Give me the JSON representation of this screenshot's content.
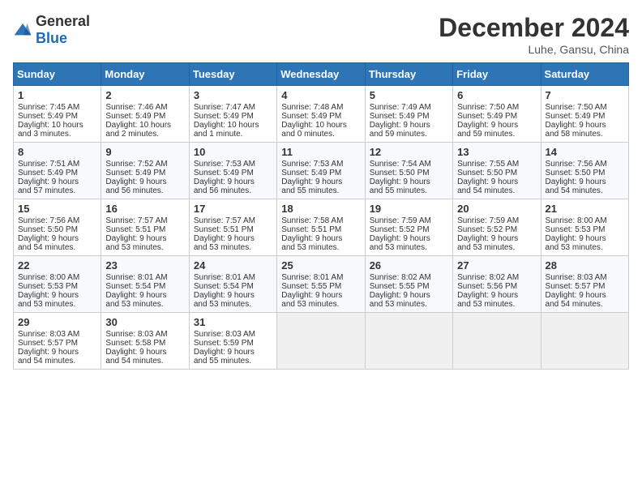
{
  "header": {
    "logo_general": "General",
    "logo_blue": "Blue",
    "month_title": "December 2024",
    "location": "Luhe, Gansu, China"
  },
  "weekdays": [
    "Sunday",
    "Monday",
    "Tuesday",
    "Wednesday",
    "Thursday",
    "Friday",
    "Saturday"
  ],
  "weeks": [
    [
      {
        "day": "1",
        "sr": "7:45 AM",
        "ss": "5:49 PM",
        "dl": "10 hours and 3 minutes."
      },
      {
        "day": "2",
        "sr": "7:46 AM",
        "ss": "5:49 PM",
        "dl": "10 hours and 2 minutes."
      },
      {
        "day": "3",
        "sr": "7:47 AM",
        "ss": "5:49 PM",
        "dl": "10 hours and 1 minute."
      },
      {
        "day": "4",
        "sr": "7:48 AM",
        "ss": "5:49 PM",
        "dl": "10 hours and 0 minutes."
      },
      {
        "day": "5",
        "sr": "7:49 AM",
        "ss": "5:49 PM",
        "dl": "9 hours and 59 minutes."
      },
      {
        "day": "6",
        "sr": "7:50 AM",
        "ss": "5:49 PM",
        "dl": "9 hours and 59 minutes."
      },
      {
        "day": "7",
        "sr": "7:50 AM",
        "ss": "5:49 PM",
        "dl": "9 hours and 58 minutes."
      }
    ],
    [
      {
        "day": "8",
        "sr": "7:51 AM",
        "ss": "5:49 PM",
        "dl": "9 hours and 57 minutes."
      },
      {
        "day": "9",
        "sr": "7:52 AM",
        "ss": "5:49 PM",
        "dl": "9 hours and 56 minutes."
      },
      {
        "day": "10",
        "sr": "7:53 AM",
        "ss": "5:49 PM",
        "dl": "9 hours and 56 minutes."
      },
      {
        "day": "11",
        "sr": "7:53 AM",
        "ss": "5:49 PM",
        "dl": "9 hours and 55 minutes."
      },
      {
        "day": "12",
        "sr": "7:54 AM",
        "ss": "5:50 PM",
        "dl": "9 hours and 55 minutes."
      },
      {
        "day": "13",
        "sr": "7:55 AM",
        "ss": "5:50 PM",
        "dl": "9 hours and 54 minutes."
      },
      {
        "day": "14",
        "sr": "7:56 AM",
        "ss": "5:50 PM",
        "dl": "9 hours and 54 minutes."
      }
    ],
    [
      {
        "day": "15",
        "sr": "7:56 AM",
        "ss": "5:50 PM",
        "dl": "9 hours and 54 minutes."
      },
      {
        "day": "16",
        "sr": "7:57 AM",
        "ss": "5:51 PM",
        "dl": "9 hours and 53 minutes."
      },
      {
        "day": "17",
        "sr": "7:57 AM",
        "ss": "5:51 PM",
        "dl": "9 hours and 53 minutes."
      },
      {
        "day": "18",
        "sr": "7:58 AM",
        "ss": "5:51 PM",
        "dl": "9 hours and 53 minutes."
      },
      {
        "day": "19",
        "sr": "7:59 AM",
        "ss": "5:52 PM",
        "dl": "9 hours and 53 minutes."
      },
      {
        "day": "20",
        "sr": "7:59 AM",
        "ss": "5:52 PM",
        "dl": "9 hours and 53 minutes."
      },
      {
        "day": "21",
        "sr": "8:00 AM",
        "ss": "5:53 PM",
        "dl": "9 hours and 53 minutes."
      }
    ],
    [
      {
        "day": "22",
        "sr": "8:00 AM",
        "ss": "5:53 PM",
        "dl": "9 hours and 53 minutes."
      },
      {
        "day": "23",
        "sr": "8:01 AM",
        "ss": "5:54 PM",
        "dl": "9 hours and 53 minutes."
      },
      {
        "day": "24",
        "sr": "8:01 AM",
        "ss": "5:54 PM",
        "dl": "9 hours and 53 minutes."
      },
      {
        "day": "25",
        "sr": "8:01 AM",
        "ss": "5:55 PM",
        "dl": "9 hours and 53 minutes."
      },
      {
        "day": "26",
        "sr": "8:02 AM",
        "ss": "5:55 PM",
        "dl": "9 hours and 53 minutes."
      },
      {
        "day": "27",
        "sr": "8:02 AM",
        "ss": "5:56 PM",
        "dl": "9 hours and 53 minutes."
      },
      {
        "day": "28",
        "sr": "8:03 AM",
        "ss": "5:57 PM",
        "dl": "9 hours and 54 minutes."
      }
    ],
    [
      {
        "day": "29",
        "sr": "8:03 AM",
        "ss": "5:57 PM",
        "dl": "9 hours and 54 minutes."
      },
      {
        "day": "30",
        "sr": "8:03 AM",
        "ss": "5:58 PM",
        "dl": "9 hours and 54 minutes."
      },
      {
        "day": "31",
        "sr": "8:03 AM",
        "ss": "5:59 PM",
        "dl": "9 hours and 55 minutes."
      },
      null,
      null,
      null,
      null
    ]
  ],
  "labels": {
    "sunrise": "Sunrise:",
    "sunset": "Sunset:",
    "daylight": "Daylight:"
  }
}
